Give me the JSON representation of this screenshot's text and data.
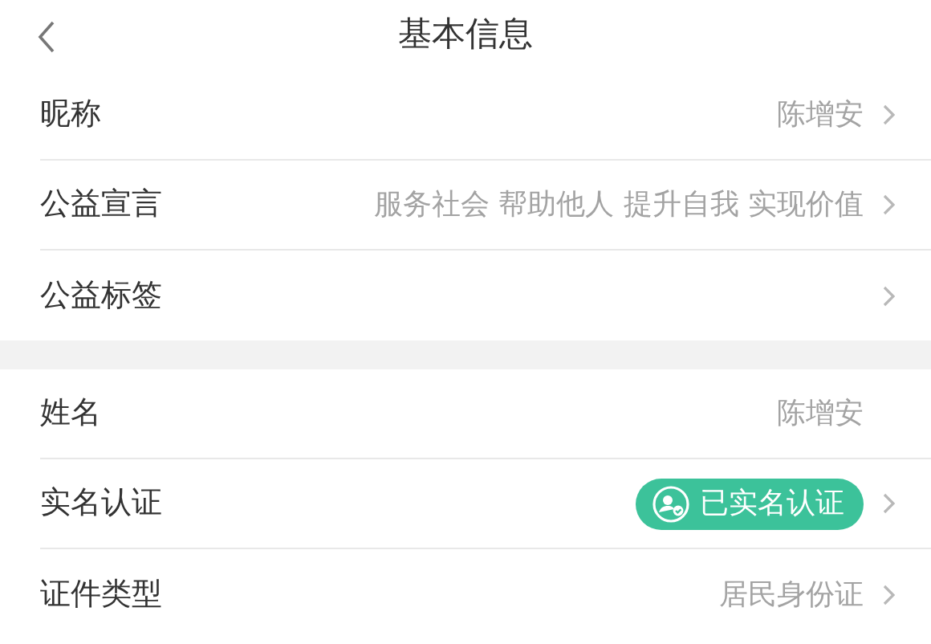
{
  "header": {
    "title": "基本信息"
  },
  "groups": [
    {
      "rows": [
        {
          "kind": "text",
          "label": "昵称",
          "value": "陈增安",
          "chevron": true
        },
        {
          "kind": "text",
          "label": "公益宣言",
          "value": "服务社会 帮助他人 提升自我 实现价值",
          "chevron": true
        },
        {
          "kind": "text",
          "label": "公益标签",
          "chevron": true
        }
      ]
    },
    {
      "rows": [
        {
          "kind": "text",
          "label": "姓名",
          "value": "陈增安",
          "chevron": false
        },
        {
          "kind": "badge",
          "label": "实名认证",
          "value": "已实名认证",
          "chevron": true
        },
        {
          "kind": "text",
          "label": "证件类型",
          "value": "居民身份证",
          "chevron": true
        }
      ]
    }
  ]
}
